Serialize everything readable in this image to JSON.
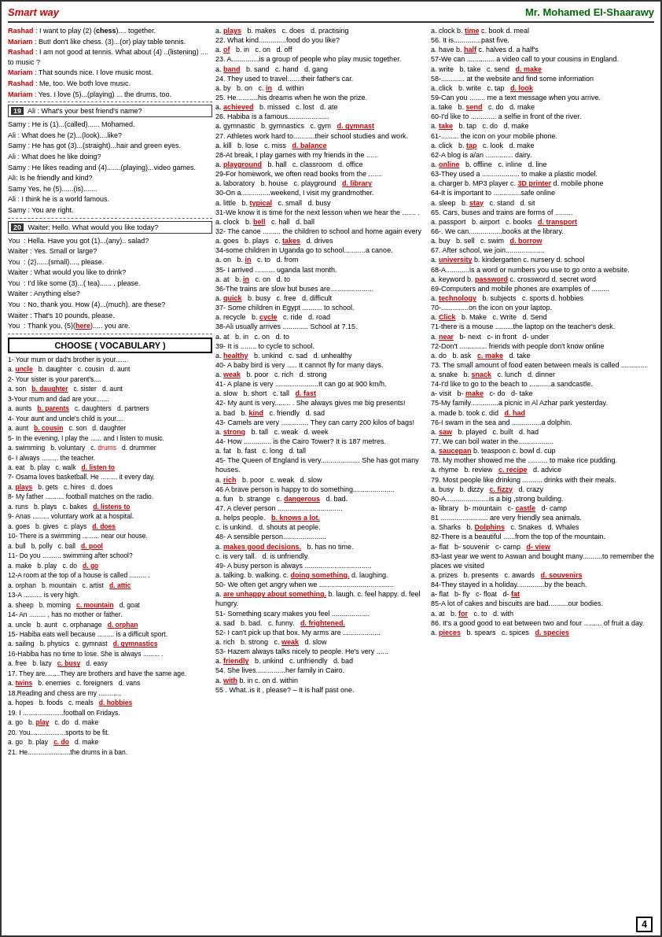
{
  "header": {
    "left": "Smart way",
    "right": "Mr. Mohamed El-Shaarawy"
  },
  "page_number": "4"
}
